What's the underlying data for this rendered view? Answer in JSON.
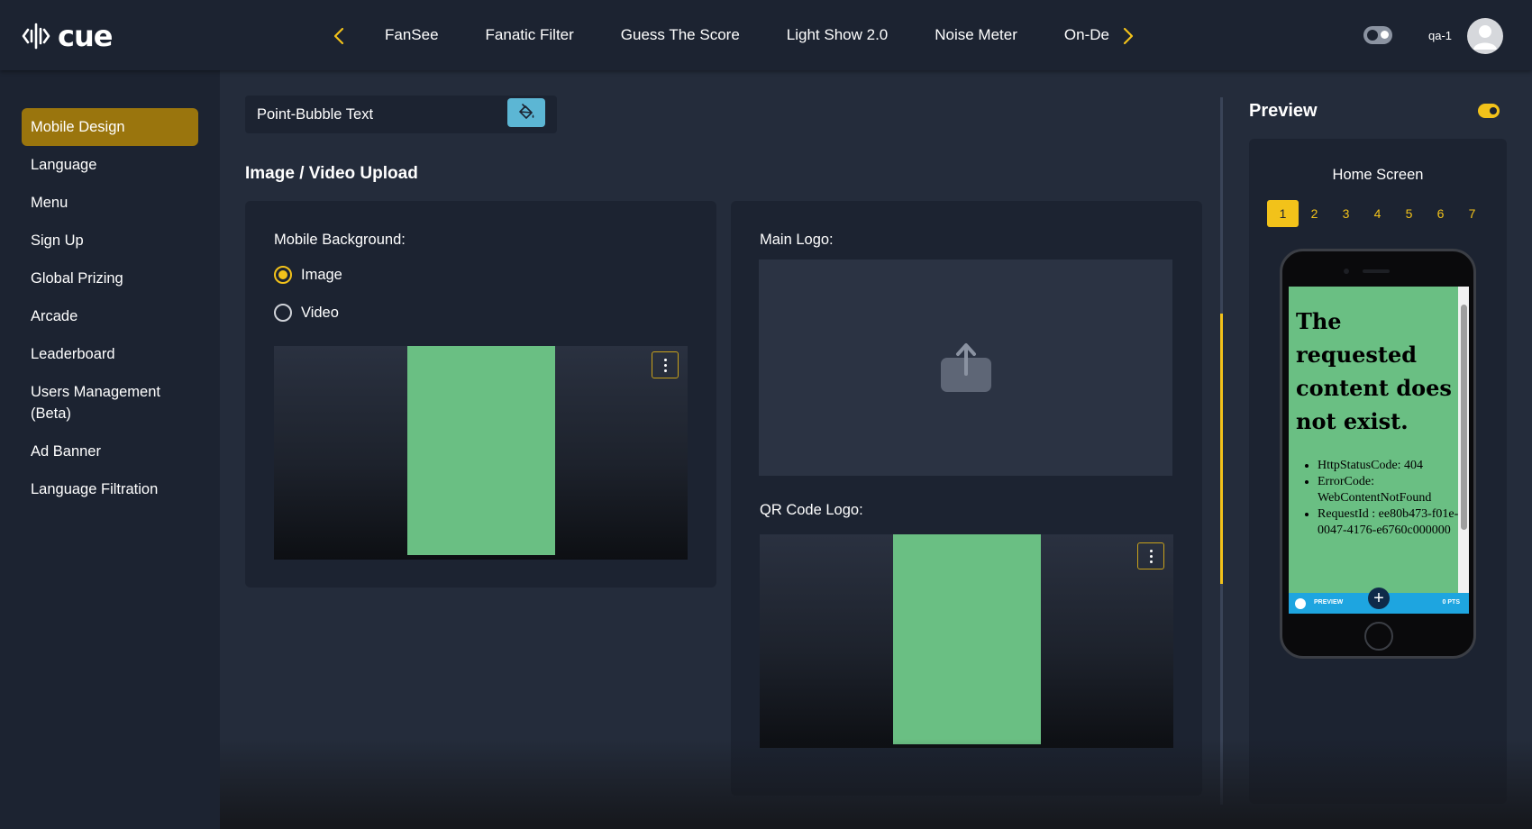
{
  "brand": {
    "name": "cue"
  },
  "topnav": {
    "prev_icon": "chevron-left-icon",
    "next_icon": "chevron-right-icon",
    "items": [
      "FanSee",
      "Fanatic Filter",
      "Guess The Score",
      "Light Show 2.0",
      "Noise Meter",
      "On-Demand"
    ]
  },
  "user": {
    "name": "qa-1",
    "avatar_icon": "user-avatar-icon",
    "theme_toggle_icon": "theme-toggle-icon"
  },
  "sidebar": {
    "items": [
      {
        "label": "Mobile Design",
        "active": true
      },
      {
        "label": "Language"
      },
      {
        "label": "Menu"
      },
      {
        "label": "Sign Up"
      },
      {
        "label": "Global Prizing"
      },
      {
        "label": "Arcade"
      },
      {
        "label": "Leaderboard"
      },
      {
        "label": "Users Management (Beta)"
      },
      {
        "label": "Ad Banner"
      },
      {
        "label": "Language Filtration"
      }
    ]
  },
  "main": {
    "bubble_row": {
      "label": "Point-Bubble Text",
      "icon": "paint-bucket-icon"
    },
    "section_title": "Image / Video Upload",
    "mobile_background": {
      "label": "Mobile Background:",
      "options": [
        {
          "label": "Image",
          "checked": true
        },
        {
          "label": "Video",
          "checked": false
        }
      ],
      "menu_icon": "more-vertical-icon"
    },
    "main_logo": {
      "label": "Main Logo:",
      "upload_icon": "upload-icon"
    },
    "qr_code_logo": {
      "label": "QR Code Logo:",
      "menu_icon": "more-vertical-icon"
    }
  },
  "preview": {
    "title": "Preview",
    "enabled": true,
    "screen_name": "Home Screen",
    "pages": [
      "1",
      "2",
      "3",
      "4",
      "5",
      "6",
      "7"
    ],
    "active_page": "1",
    "error_heading": "The requested content does not exist.",
    "error_items": [
      "HttpStatusCode: 404",
      "ErrorCode: WebContentNotFound",
      "RequestId : ee80b473-f01e-0047-4176-e6760c000000"
    ],
    "app_bar": {
      "left_label": "PREVIEW",
      "right_label": "0 PTS"
    }
  },
  "colors": {
    "accent": "#f2c21a",
    "active_nav": "#9a750d",
    "panel": "#1c2331",
    "background": "#242c3b",
    "placeholder_green": "#6abf83",
    "paint_button": "#5cb6d4"
  }
}
